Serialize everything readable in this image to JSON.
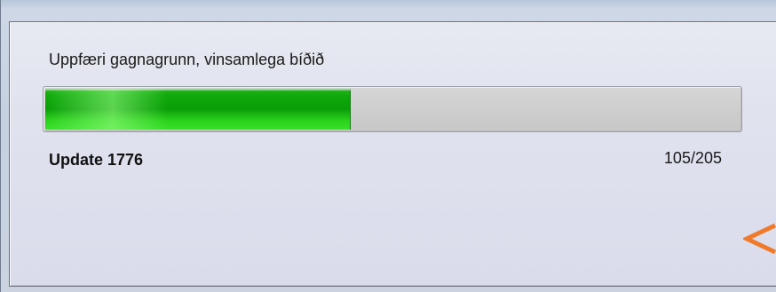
{
  "dialog": {
    "message": "Uppfæri gagnagrunn, vinsamlega bíðið",
    "status": "Update 1776",
    "progress": {
      "current": 105,
      "total": 205,
      "text": "105/205",
      "fraction": 0.44
    }
  },
  "colors": {
    "progress_fill": "#0fa80c",
    "progress_track": "#cfcfcf",
    "annotation_arrow": "#f07a2a"
  },
  "icons": {
    "annotation": "arrow-pointer-icon"
  }
}
